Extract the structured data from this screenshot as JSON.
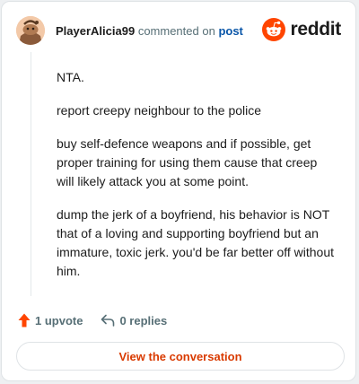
{
  "header": {
    "username": "PlayerAlicia99",
    "action_text": "commented on",
    "target_link": "post"
  },
  "brand": {
    "wordmark": "reddit",
    "icon": "reddit-snoo-icon",
    "color": "#ff4500"
  },
  "avatar": {
    "icon": "snoo-avatar-icon"
  },
  "comment": {
    "paragraphs": [
      "NTA.",
      "report creepy neighbour to the police",
      "buy self-defence weapons and if possible, get proper training for using them cause that creep will likely attack you at some point.",
      "dump the jerk of a boyfriend, his behavior is NOT that of a loving and supporting boyfriend but an immature, toxic jerk. you'd be far better off without him."
    ]
  },
  "actions": {
    "upvote_label": "1 upvote",
    "upvote_icon": "upvote-arrow-icon",
    "reply_label": "0 replies",
    "reply_icon": "reply-arrow-icon"
  },
  "cta": {
    "label": "View the conversation"
  },
  "colors": {
    "accent": "#d93a00",
    "upvote": "#ff4500",
    "link": "#0a56a8",
    "muted": "#576f76"
  }
}
